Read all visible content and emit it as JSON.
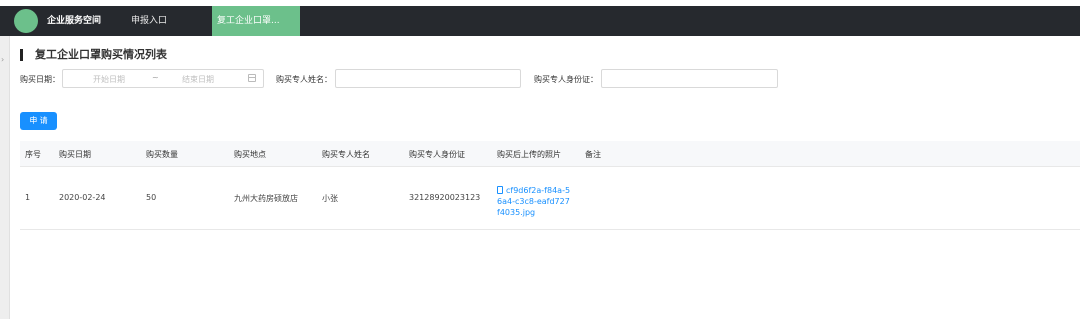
{
  "navbar": {
    "brand": "企业服务空间",
    "items": [
      {
        "label": "申报入口"
      },
      {
        "label": "复工企业口罩..."
      }
    ]
  },
  "page": {
    "title": "复工企业口罩购买情况列表"
  },
  "filters": {
    "date_label": "购买日期：",
    "start_placeholder": "开始日期",
    "range_separator": "~",
    "end_placeholder": "结束日期",
    "name_label": "购买专人姓名：",
    "name_value": "",
    "id_label": "购买专人身份证：",
    "id_value": ""
  },
  "actions": {
    "apply_label": "申 请"
  },
  "table": {
    "columns": [
      "序号",
      "购买日期",
      "购买数量",
      "购买地点",
      "购买专人姓名",
      "购买专人身份证",
      "购买后上传的照片",
      "备注"
    ],
    "rows": [
      {
        "index": "1",
        "date": "2020-02-24",
        "quantity": "50",
        "location": "九州大药房硕放店",
        "name": "小张",
        "id_card": "32128920023123",
        "photo": "cf9d6f2a-f84a-56a4-c3c8-eafd727f4035.jpg",
        "remark": ""
      }
    ]
  },
  "colors": {
    "navbar_bg": "#26292e",
    "active_tab": "#6cc08b",
    "primary_button": "#1890ff",
    "link": "#1890ff"
  }
}
